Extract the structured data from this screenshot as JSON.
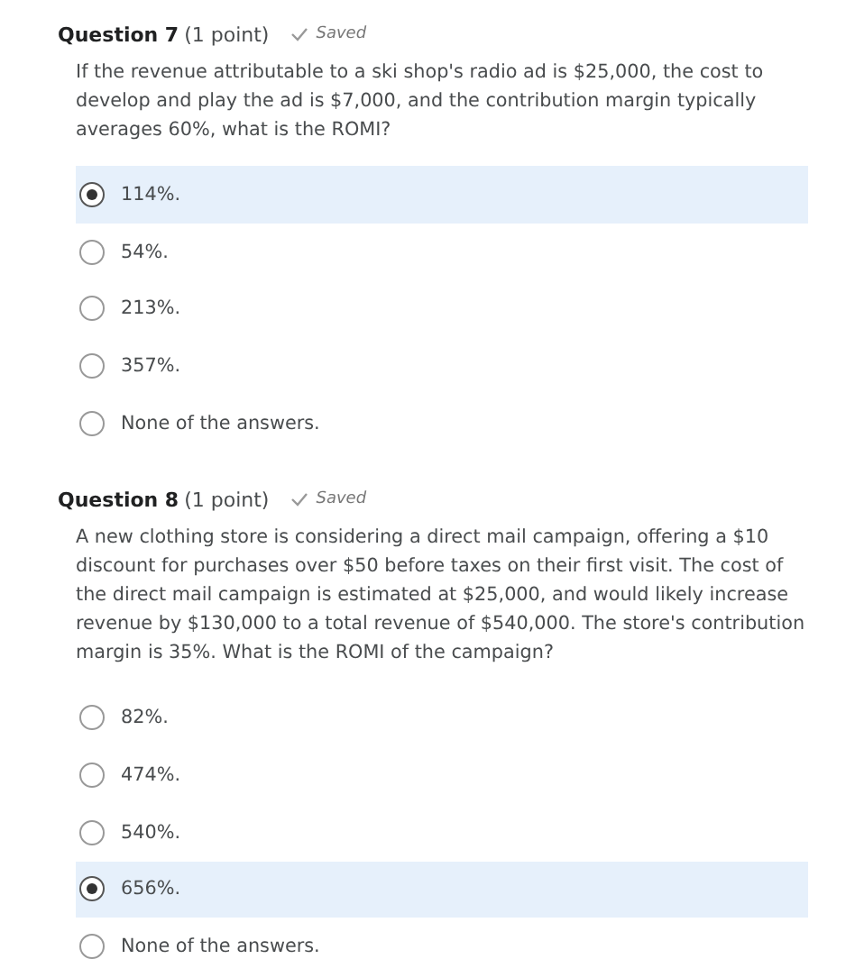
{
  "questions": [
    {
      "title": "Question 7",
      "points": "(1 point)",
      "status": "Saved",
      "text": "If the revenue attributable to a ski shop's radio ad is $25,000, the cost to develop and play the ad is $7,000, and the contribution margin typically averages 60%, what is the ROMI?",
      "options": [
        {
          "label": "114%.",
          "selected": true
        },
        {
          "label": "54%.",
          "selected": false
        },
        {
          "label": "213%.",
          "selected": false
        },
        {
          "label": "357%.",
          "selected": false
        },
        {
          "label": "None of the answers.",
          "selected": false
        }
      ]
    },
    {
      "title": "Question 8",
      "points": "(1 point)",
      "status": "Saved",
      "text": "A new clothing store is considering a direct mail campaign, offering a $10 discount for purchases over $50 before taxes on their first visit. The cost of the direct mail campaign is estimated at $25,000, and would likely increase revenue by $130,000 to a total revenue of $540,000. The store's contribution margin is 35%. What is the ROMI of the campaign?",
      "options": [
        {
          "label": "82%.",
          "selected": false
        },
        {
          "label": "474%.",
          "selected": false
        },
        {
          "label": "540%.",
          "selected": false
        },
        {
          "label": "656%.",
          "selected": true
        },
        {
          "label": "None of the answers.",
          "selected": false
        }
      ]
    }
  ]
}
